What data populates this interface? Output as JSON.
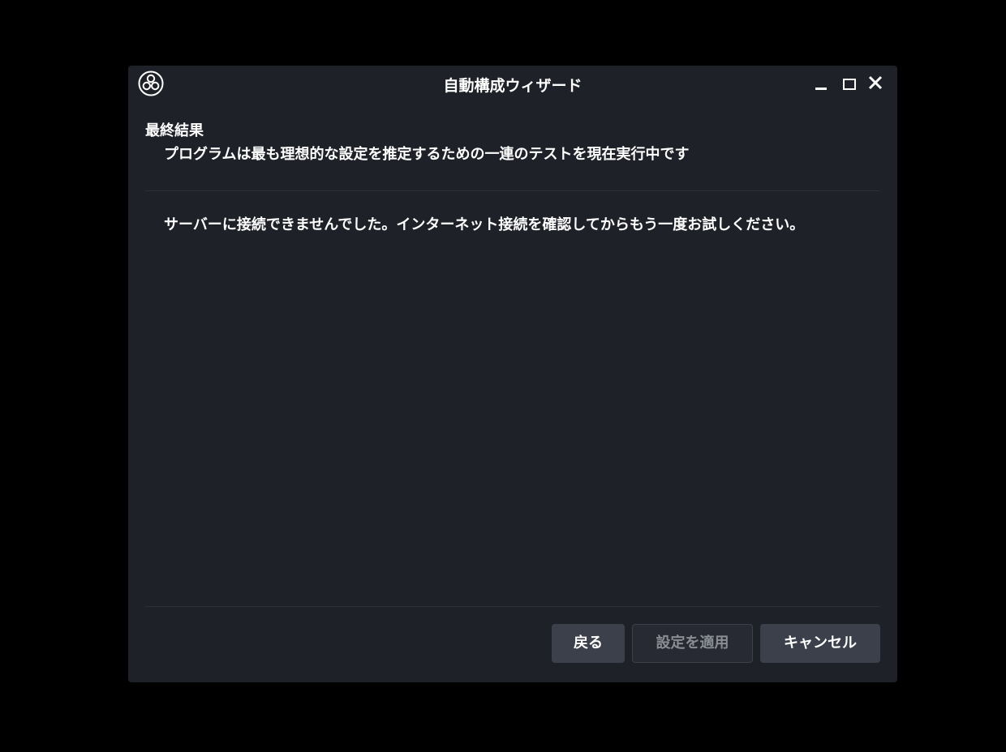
{
  "window": {
    "title": "自動構成ウィザード",
    "controls": {
      "minimize": "minimize-icon",
      "maximize": "maximize-icon",
      "close": "close-icon"
    },
    "logo": "obs-logo-icon"
  },
  "page": {
    "heading": "最終結果",
    "subheading": "プログラムは最も理想的な設定を推定するための一連のテストを現在実行中です",
    "message": "サーバーに接続できませんでした。インターネット接続を確認してからもう一度お試しください。"
  },
  "buttons": {
    "back": "戻る",
    "apply": "設定を適用",
    "cancel": "キャンセル"
  },
  "colors": {
    "background": "#000000",
    "window": "#1f2128",
    "button": "#3c404b",
    "disabled_text": "#8a8d94"
  }
}
